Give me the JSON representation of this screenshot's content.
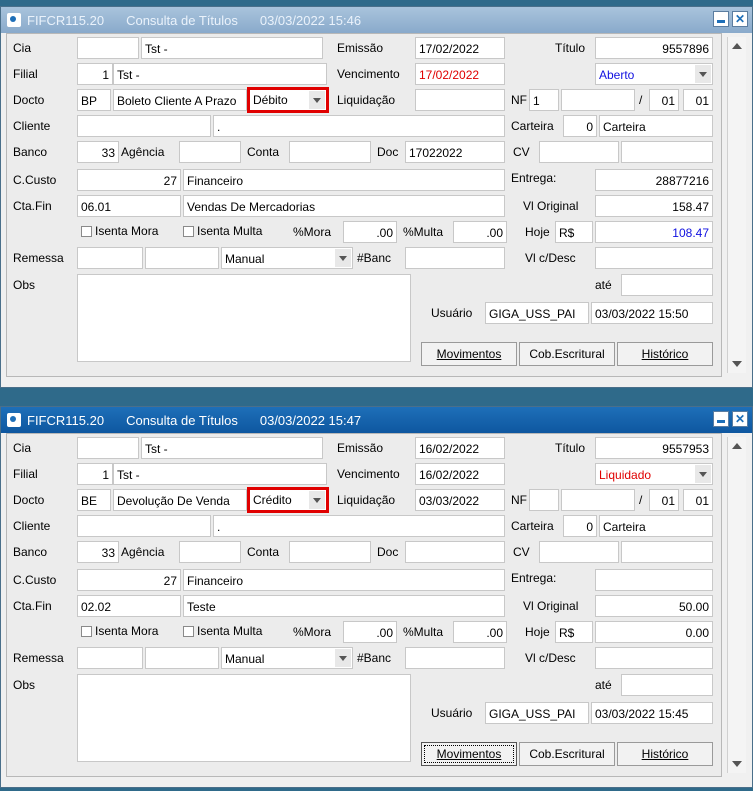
{
  "windows": [
    {
      "title": {
        "code": "FIFCR115.20",
        "name": "Consulta de Títulos",
        "datetime": "03/03/2022 15:46"
      },
      "labels": {
        "cia": "Cia",
        "filial": "Filial",
        "docto": "Docto",
        "cliente": "Cliente",
        "banco": "Banco",
        "agencia": "Agência",
        "conta": "Conta",
        "doc": "Doc",
        "ccusto": "C.Custo",
        "ctafin": "Cta.Fin",
        "remessa": "Remessa",
        "bancnum": "#Banc",
        "obs": "Obs",
        "emissao": "Emissão",
        "vencimento": "Vencimento",
        "liquidacao": "Liquidação",
        "titulo": "Título",
        "nf": "NF",
        "slash": "/",
        "carteira": "Carteira",
        "cv": "CV",
        "entrega": "Entrega:",
        "vloriginal": "Vl Original",
        "hoje": "Hoje",
        "vlcdesc": "Vl c/Desc",
        "ate": "até",
        "usuario": "Usuário",
        "isenta_mora": "Isenta Mora",
        "isenta_multa": "Isenta Multa",
        "pmora": "%Mora",
        "pmulta": "%Multa"
      },
      "values": {
        "cia_desc": "Tst -",
        "filial_num": "1",
        "filial_desc": "Tst -",
        "docto_code": "BP",
        "docto_desc": "Boleto Cliente A Prazo",
        "docto_type": "Débito",
        "cliente_desc": ".",
        "banco_num": "33",
        "doc": "17022022",
        "ccusto_num": "27",
        "ccusto_desc": "Financeiro",
        "ctafin_code": "06.01",
        "ctafin_desc": "Vendas De Mercadorias",
        "pmora": ".00",
        "pmulta": ".00",
        "remessa_mode": "Manual",
        "emissao": "17/02/2022",
        "vencimento": "17/02/2022",
        "liquidacao": "",
        "titulo": "9557896",
        "status": "Aberto",
        "nf_num": "1",
        "nf_serie": "01",
        "nf_parc": "01",
        "carteira_num": "0",
        "carteira_desc": "Carteira",
        "entrega": "28877216",
        "vloriginal": "158.47",
        "hoje_cur": "R$",
        "hoje_val": "108.47",
        "usuario": "GIGA_USS_PAI",
        "usuario_dt": "03/03/2022 15:50"
      },
      "buttons": {
        "movimentos": "Movimentos",
        "cob": "Cob.Escritural",
        "historico": "Histórico"
      }
    },
    {
      "title": {
        "code": "FIFCR115.20",
        "name": "Consulta de Títulos",
        "datetime": "03/03/2022 15:47"
      },
      "labels": {
        "cia": "Cia",
        "filial": "Filial",
        "docto": "Docto",
        "cliente": "Cliente",
        "banco": "Banco",
        "agencia": "Agência",
        "conta": "Conta",
        "doc": "Doc",
        "ccusto": "C.Custo",
        "ctafin": "Cta.Fin",
        "remessa": "Remessa",
        "bancnum": "#Banc",
        "obs": "Obs",
        "emissao": "Emissão",
        "vencimento": "Vencimento",
        "liquidacao": "Liquidação",
        "titulo": "Título",
        "nf": "NF",
        "slash": "/",
        "carteira": "Carteira",
        "cv": "CV",
        "entrega": "Entrega:",
        "vloriginal": "Vl Original",
        "hoje": "Hoje",
        "vlcdesc": "Vl c/Desc",
        "ate": "até",
        "usuario": "Usuário",
        "isenta_mora": "Isenta Mora",
        "isenta_multa": "Isenta Multa",
        "pmora": "%Mora",
        "pmulta": "%Multa"
      },
      "values": {
        "cia_desc": "Tst -",
        "filial_num": "1",
        "filial_desc": "Tst -",
        "docto_code": "BE",
        "docto_desc": "Devolução De Venda",
        "docto_type": "Crédito",
        "cliente_desc": ".",
        "banco_num": "33",
        "doc": "",
        "ccusto_num": "27",
        "ccusto_desc": "Financeiro",
        "ctafin_code": "02.02",
        "ctafin_desc": "Teste",
        "pmora": ".00",
        "pmulta": ".00",
        "remessa_mode": "Manual",
        "emissao": "16/02/2022",
        "vencimento": "16/02/2022",
        "liquidacao": "03/03/2022",
        "titulo": "9557953",
        "status": "Liquidado",
        "nf_num": "",
        "nf_serie": "01",
        "nf_parc": "01",
        "carteira_num": "0",
        "carteira_desc": "Carteira",
        "entrega": "",
        "vloriginal": "50.00",
        "hoje_cur": "R$",
        "hoje_val": "0.00",
        "usuario": "GIGA_USS_PAI",
        "usuario_dt": "03/03/2022 15:45"
      },
      "buttons": {
        "movimentos": "Movimentos",
        "cob": "Cob.Escritural",
        "historico": "Histórico"
      }
    }
  ],
  "colors": {
    "status_aberto": "#1010e0",
    "status_liquidado": "#e00000",
    "highlight": "#e00000"
  }
}
